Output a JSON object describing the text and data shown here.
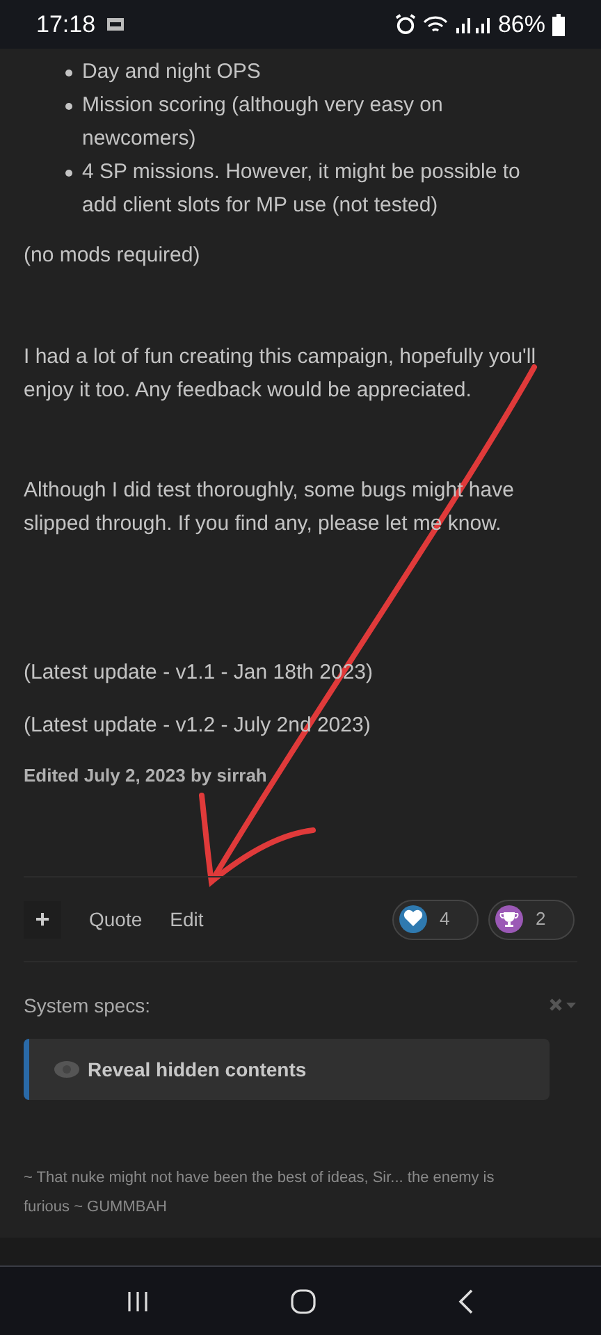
{
  "status_bar": {
    "time": "17:18",
    "battery": "86%"
  },
  "post": {
    "bullets": [
      "Day and night OPS",
      "Mission scoring (although very easy on newcomers)",
      "4 SP missions. However, it might be possible to add client slots for MP use (not tested)"
    ],
    "paragraphs": [
      "(no mods required)",
      "I had a lot of fun creating this campaign, hopefully you'll enjoy it too. Any feedback would be appreciated.",
      "Although I did test thoroughly, some bugs might have slipped through. If you find any, please let me know.",
      "(Latest update - v1.1 - Jan 18th 2023)",
      "(Latest update - v1.2 - July 2nd 2023)"
    ],
    "edited": "Edited July 2, 2023 by sirrah"
  },
  "actions": {
    "plus": "+",
    "links": [
      "Quote",
      "Edit"
    ],
    "reactions": [
      {
        "kind": "heart",
        "count": "4",
        "color": "#2f7ab0"
      },
      {
        "kind": "trophy",
        "count": "2",
        "color": "#9b59b6"
      }
    ]
  },
  "signature": {
    "label": "System specs:",
    "reveal": "Reveal hidden contents",
    "quote": "~ That nuke might not have been the best of ideas, Sir... the enemy is furious ~ GUMMBAH"
  }
}
